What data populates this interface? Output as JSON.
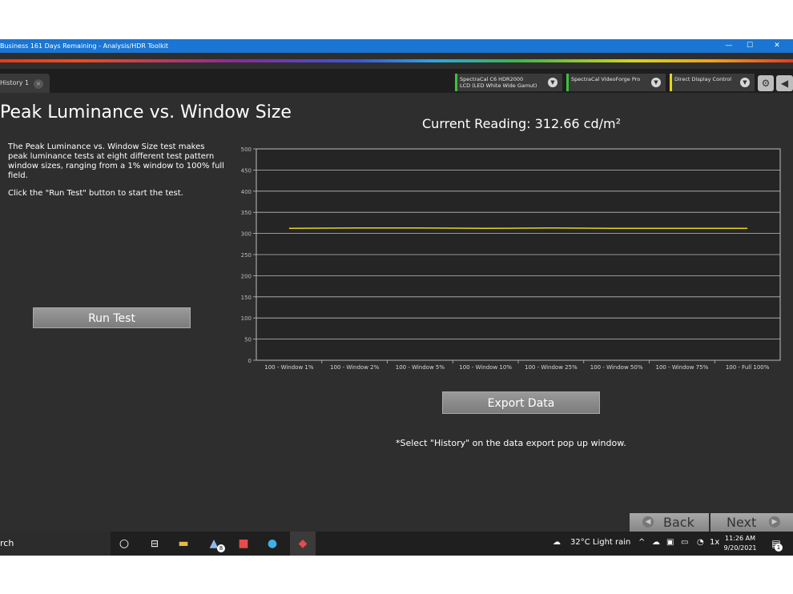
{
  "window": {
    "title": "Business 161 Days Remaining  - Analysis/HDR Toolkit",
    "minimize": "—",
    "maximize": "☐",
    "close": "✕"
  },
  "tabs": [
    {
      "label": "History 1",
      "close": "×"
    }
  ],
  "devices": [
    {
      "line1": "SpectraCal C6 HDR2000",
      "line2": "LCD (LED White Wide Gamut)",
      "color": "#3cc23c"
    },
    {
      "line1": "SpectraCal VideoForge Pro",
      "line2": "",
      "color": "#3cc23c"
    },
    {
      "line1": "Direct Display Control",
      "line2": "",
      "color": "#e6d619"
    }
  ],
  "colors": {
    "background": "#2e2e2e",
    "plot_bg": "#252525",
    "line": "#e6d619",
    "titlebar": "#1a76d2"
  },
  "page": {
    "title": "Peak Luminance vs. Window Size",
    "description": [
      "The Peak Luminance vs. Window Size test makes peak luminance tests at eight different test pattern window sizes, ranging from a 1% window to 100% full field.",
      "Click the \"Run Test\" button to start the test."
    ],
    "run_test": "Run Test",
    "current_reading": "Current Reading: 312.66 cd/m²",
    "export_data": "Export  Data",
    "export_note": "*Select \"History\" on the data export pop up window.",
    "back": "Back",
    "next": "Next"
  },
  "chart_data": {
    "type": "line",
    "categories": [
      "100 - Window  1%",
      "100 - Window  2%",
      "100 - Window  5%",
      "100 - Window 10%",
      "100 - Window 25%",
      "100 - Window 50%",
      "100 - Window 75%",
      "100 - Full  100%"
    ],
    "series": [
      {
        "values": [
          312,
          313,
          313,
          312,
          313,
          312,
          312,
          312
        ]
      }
    ],
    "ylim": [
      0,
      500
    ],
    "yticks": [
      0,
      50,
      100,
      150,
      200,
      250,
      300,
      350,
      400,
      450,
      500
    ],
    "grid": true
  },
  "taskbar": {
    "search": "rch",
    "weather": "32°C  Light rain",
    "lang": "1x",
    "time": "11:26 AM",
    "date": "9/20/2021",
    "store_badge": "8",
    "notification_badge": "1"
  }
}
